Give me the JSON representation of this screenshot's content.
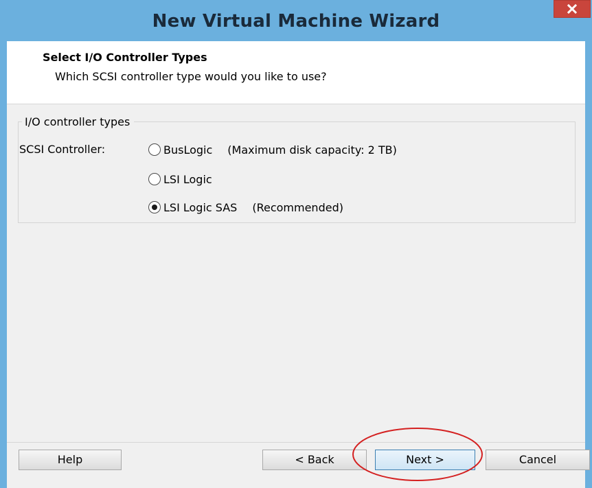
{
  "window": {
    "title": "New Virtual Machine Wizard"
  },
  "header": {
    "title": "Select I/O Controller Types",
    "subtitle": "Which SCSI controller type would you like to use?"
  },
  "controller_group": {
    "legend": "I/O controller types",
    "field_label": "SCSI Controller:",
    "options": [
      {
        "label": "BusLogic",
        "note": "(Maximum disk capacity: 2 TB)",
        "selected": false
      },
      {
        "label": "LSI Logic",
        "note": "",
        "selected": false
      },
      {
        "label": "LSI Logic SAS",
        "note": "(Recommended)",
        "selected": true
      }
    ]
  },
  "footer": {
    "help_label": "Help",
    "back_label": "< Back",
    "next_label": "Next >",
    "cancel_label": "Cancel"
  },
  "colors": {
    "titlebar": "#6bb0de",
    "close_button": "#c9453c",
    "highlight": "#d42020"
  }
}
